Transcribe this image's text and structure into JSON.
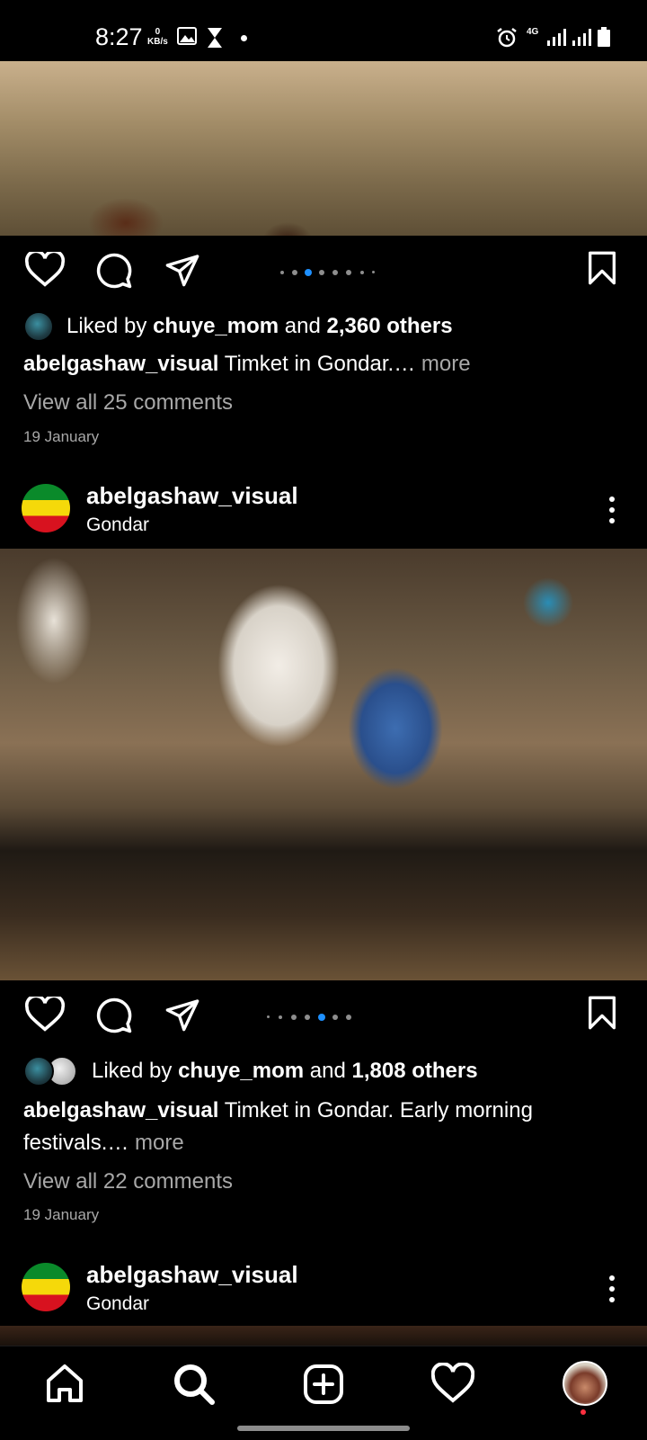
{
  "status_bar": {
    "time": "8:27",
    "net_speed_value": "0",
    "net_speed_unit": "KB/s",
    "network": "4G"
  },
  "post1": {
    "liked_prefix": "Liked by",
    "liked_user": "chuye_mom",
    "liked_and": "and",
    "liked_count": "2,360 others",
    "caption_user": "abelgashaw_visual",
    "caption_text": "Timket in Gondar.…",
    "more": "more",
    "view_all": "View all 25 comments",
    "date": "19 January",
    "carousel_active_index": 2
  },
  "post2": {
    "username": "abelgashaw_visual",
    "location": "Gondar",
    "liked_prefix": "Liked by",
    "liked_user": "chuye_mom",
    "liked_and": "and",
    "liked_count": "1,808 others",
    "caption_user": "abelgashaw_visual",
    "caption_text": "Timket in Gondar. Early morning festivals.…",
    "more": "more",
    "view_all": "View all 22 comments",
    "date": "19 January",
    "carousel_active_index": 4
  },
  "post3": {
    "username": "abelgashaw_visual",
    "location": "Gondar"
  },
  "colors": {
    "accent": "#1e90ff",
    "notification": "#ff3040",
    "flag_green": "#0a8a2a",
    "flag_yellow": "#f5d90a",
    "flag_red": "#d8121f"
  },
  "icons": [
    "heart-icon",
    "comment-icon",
    "share-icon",
    "bookmark-icon",
    "more-icon",
    "home-icon",
    "search-icon",
    "create-icon",
    "activity-icon",
    "profile-avatar"
  ]
}
